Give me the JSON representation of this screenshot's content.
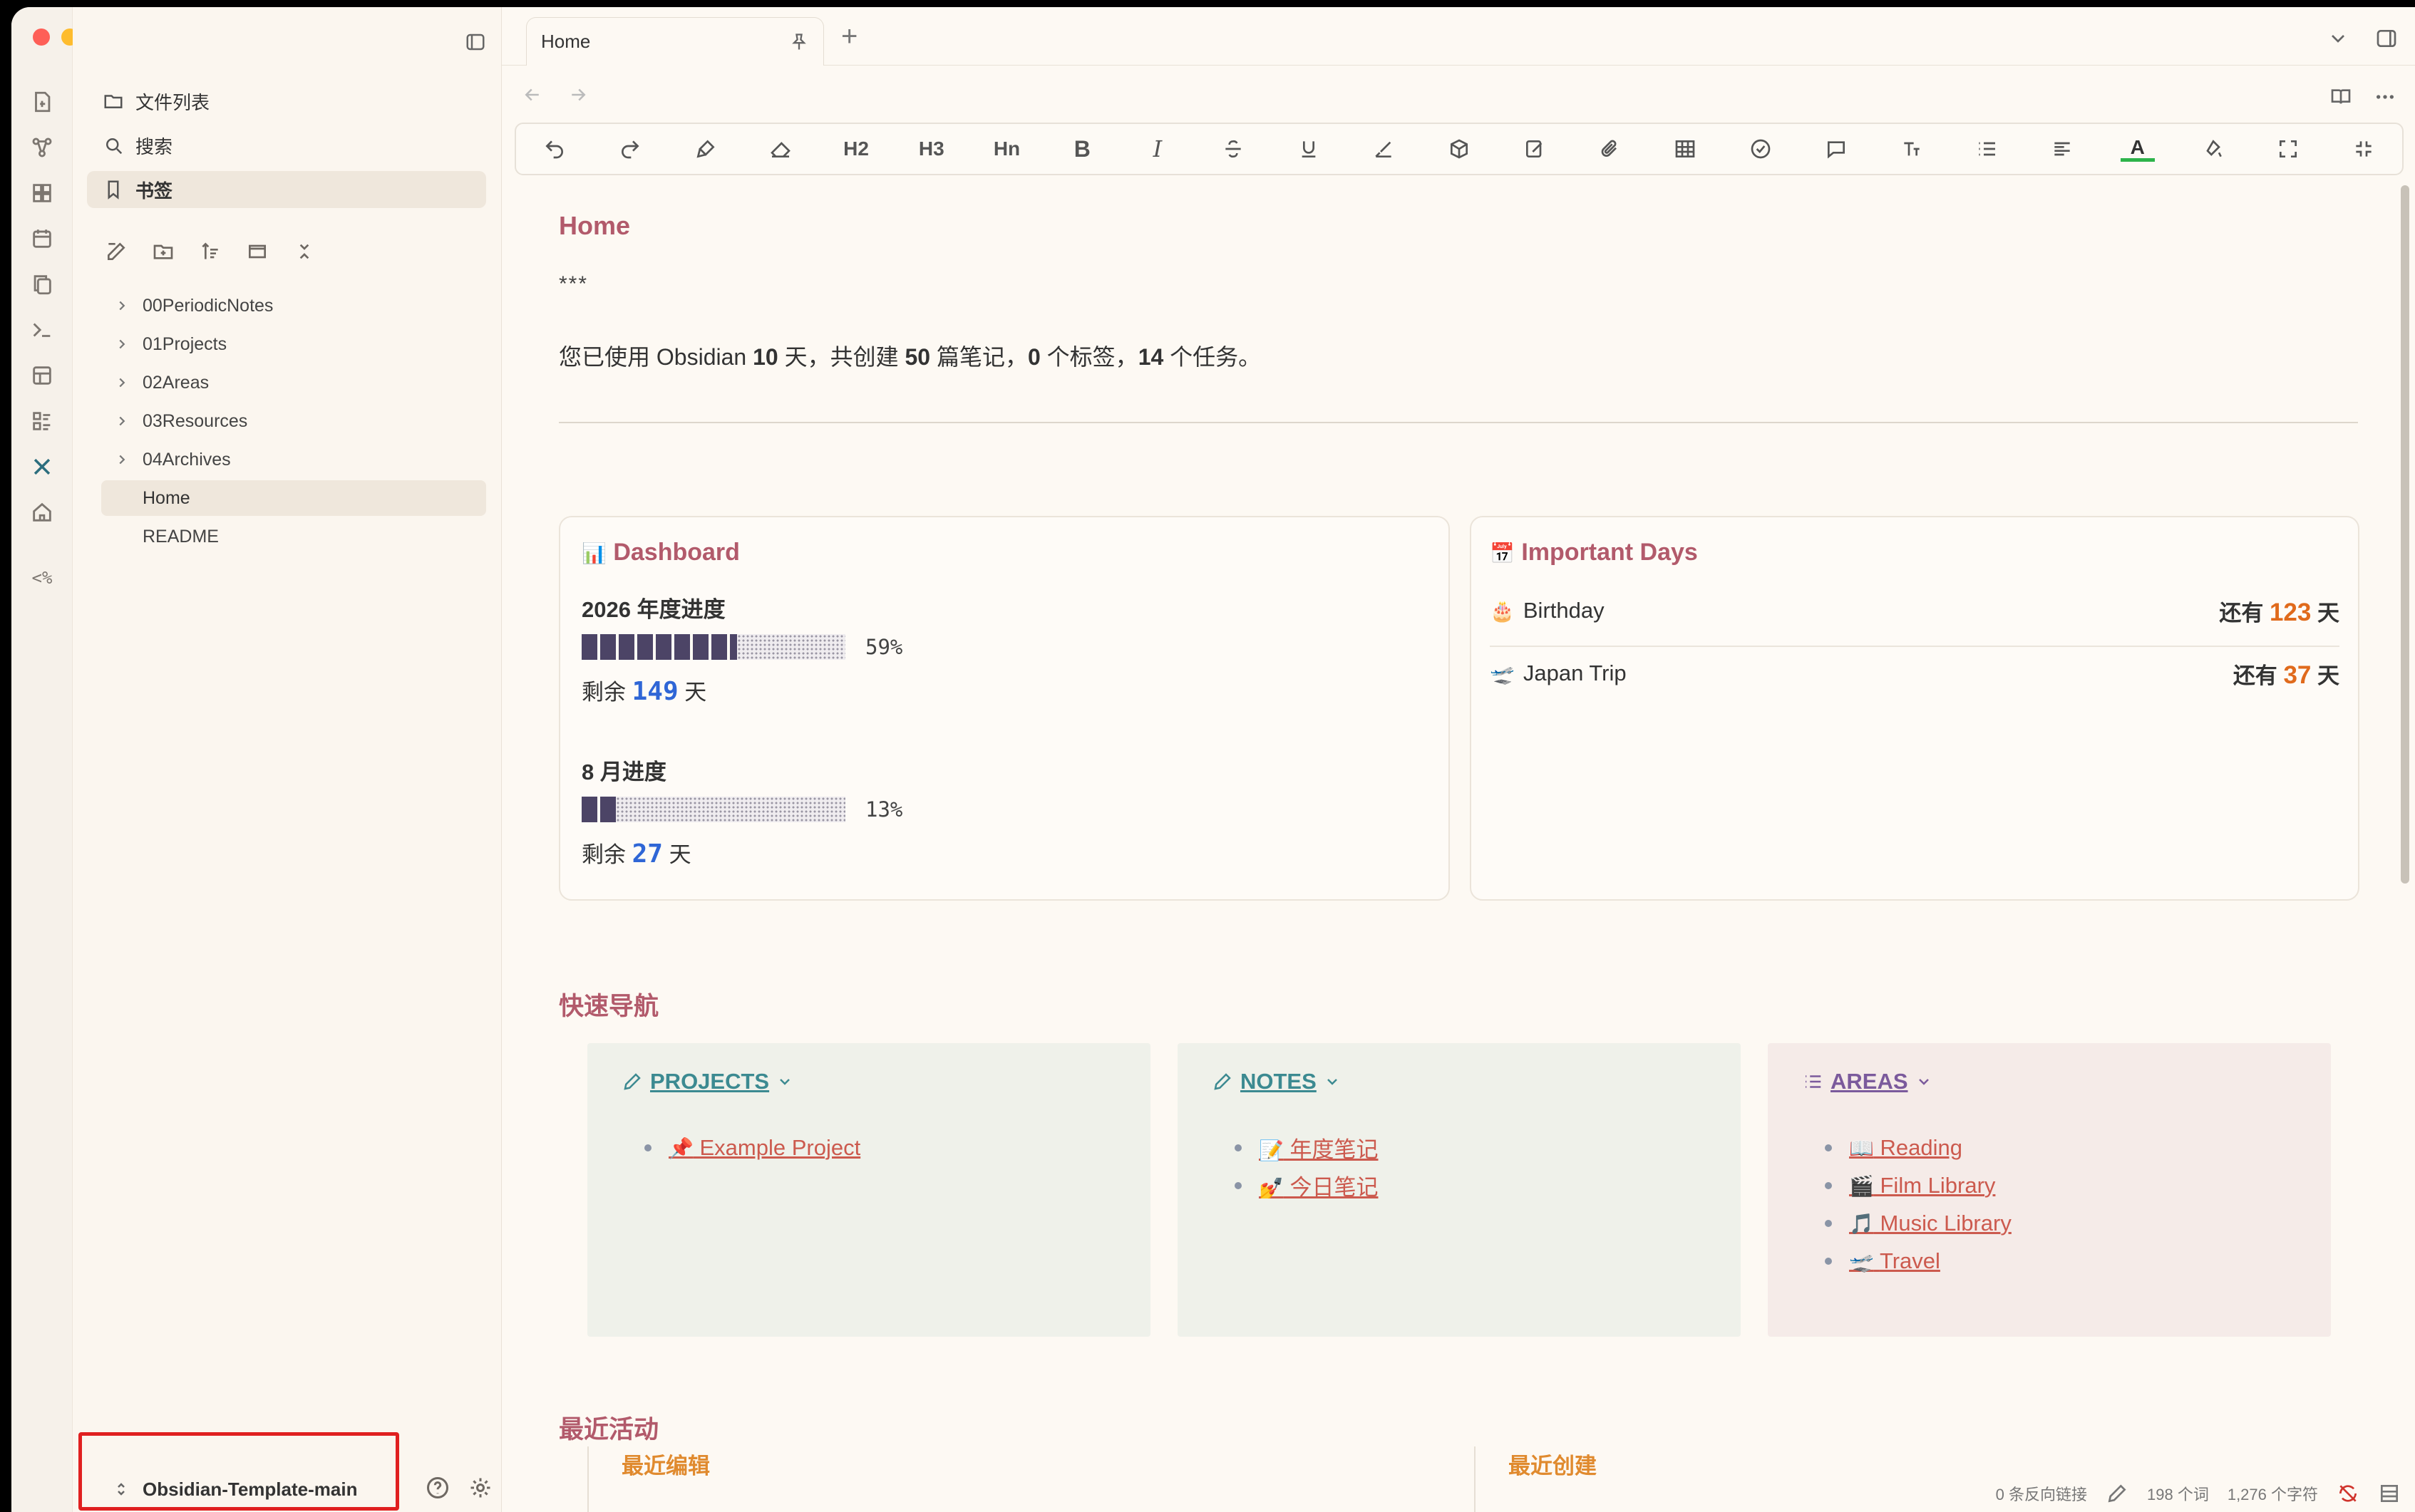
{
  "tab": {
    "title": "Home"
  },
  "sidebar": {
    "top_items": [
      {
        "label": "文件列表",
        "icon": "folder-icon"
      },
      {
        "label": "搜索",
        "icon": "search-icon"
      },
      {
        "label": "书签",
        "icon": "bookmark-icon"
      }
    ],
    "tree": [
      {
        "label": "00PeriodicNotes",
        "folder": true
      },
      {
        "label": "01Projects",
        "folder": true
      },
      {
        "label": "02Areas",
        "folder": true
      },
      {
        "label": "03Resources",
        "folder": true
      },
      {
        "label": "04Archives",
        "folder": true
      },
      {
        "label": "Home",
        "folder": false,
        "active": true
      },
      {
        "label": "README",
        "folder": false
      }
    ],
    "vault": "Obsidian-Template-main"
  },
  "ribbon": {
    "template_glyph": "<%"
  },
  "toolbar": {
    "h2": "H2",
    "h3": "H3",
    "hn": "Hn",
    "bold": "B",
    "italic": "I",
    "font_color": "A"
  },
  "note": {
    "title": "Home",
    "stars": "***",
    "stat": {
      "prefix": "您已使用 Obsidian ",
      "days": "10",
      "part1": " 天，共创建 ",
      "notes": "50",
      "part2": " 篇笔记，",
      "tags": "0",
      "part3": " 个标签，",
      "tasks": "14",
      "part4": " 个任务。"
    },
    "dashboard": {
      "title": "Dashboard",
      "year_label": "2026 年度进度",
      "year_progress": 0.59,
      "year_pct": "59%",
      "year_remain_prefix": "剩余 ",
      "year_remain": "149",
      "year_remain_suffix": " 天",
      "month_label": "8 月进度",
      "month_progress": 0.13,
      "month_pct": "13%",
      "month_remain_prefix": "剩余 ",
      "month_remain": "27",
      "month_remain_suffix": " 天"
    },
    "important_days": {
      "title": "Important Days",
      "items": [
        {
          "emoji": "🎂",
          "name": "Birthday",
          "prefix": "还有 ",
          "count": "123",
          "suffix": " 天"
        },
        {
          "emoji": "🛫",
          "name": "Japan Trip",
          "prefix": "还有 ",
          "count": "37",
          "suffix": " 天"
        }
      ]
    },
    "quick_nav": {
      "heading": "快速导航",
      "projects": {
        "title": "PROJECTS",
        "items": [
          {
            "emoji": "📌",
            "label": "Example Project"
          }
        ]
      },
      "notes": {
        "title": "NOTES",
        "items": [
          {
            "emoji": "📝",
            "label": "年度笔记"
          },
          {
            "emoji": "💅",
            "label": "今日笔记"
          }
        ]
      },
      "areas": {
        "title": "AREAS",
        "items": [
          {
            "emoji": "📖",
            "label": "Reading"
          },
          {
            "emoji": "🎬",
            "label": "Film Library"
          },
          {
            "emoji": "🎵",
            "label": "Music Library"
          },
          {
            "emoji": "🛫",
            "label": "Travel"
          }
        ]
      }
    },
    "recent": {
      "heading": "最近活动",
      "edited": "最近编辑",
      "created": "最近创建"
    }
  },
  "statusbar": {
    "backlinks": "0 条反向链接",
    "words": "198 个词",
    "chars": "1,276 个字符"
  },
  "colors": {
    "accent": "#b25a6b",
    "link": "#cc5a4e",
    "number_blue": "#2f66d6",
    "number_orange": "#e06a1c",
    "highlight_red": "#e02020"
  }
}
